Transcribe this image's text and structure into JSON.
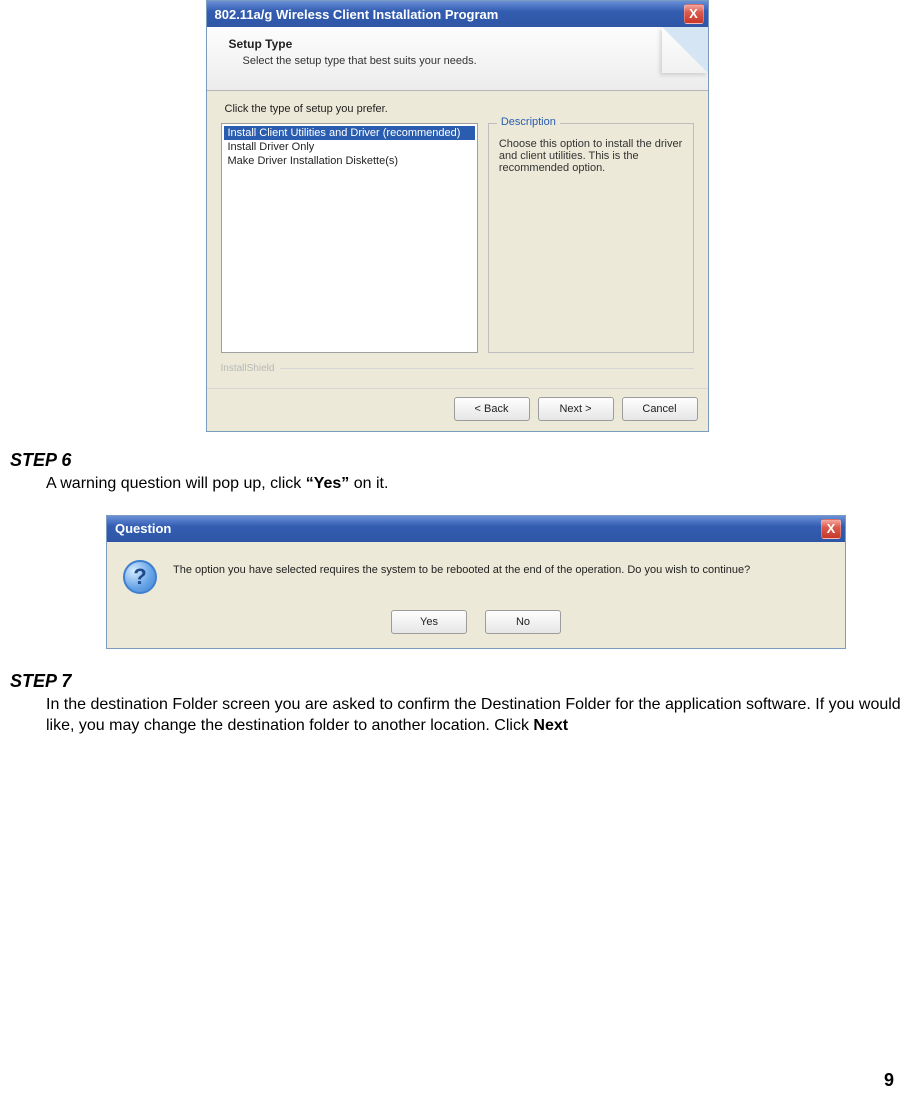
{
  "dialog1": {
    "title": "802.11a/g  Wireless Client Installation Program",
    "close": "X",
    "banner": {
      "title": "Setup Type",
      "desc": "Select the setup type that best suits your needs."
    },
    "prompt": "Click the type of setup you prefer.",
    "options": [
      "Install Client Utilities and Driver (recommended)",
      "Install Driver Only",
      "Make Driver Installation Diskette(s)"
    ],
    "descPanel": {
      "legend": "Description",
      "text": "Choose this option to install the driver and client utilities. This is the recommended option."
    },
    "installShield": "InstallShield",
    "buttons": {
      "back": "< Back",
      "next": "Next >",
      "cancel": "Cancel"
    }
  },
  "step6": {
    "label": "STEP 6",
    "text_prefix": "A warning question will pop up, click ",
    "text_bold": "“Yes”",
    "text_suffix": " on it."
  },
  "dialog2": {
    "title": "Question",
    "close": "X",
    "icon": "?",
    "message": "The option you have selected requires the system to be rebooted at the end of the operation. Do you wish to continue?",
    "buttons": {
      "yes": "Yes",
      "no": "No"
    }
  },
  "step7": {
    "label": "STEP 7",
    "text_prefix": "In the destination Folder screen you are asked to confirm the Destination Folder for the application software. If you would like, you may change the destination folder to another location. Click ",
    "text_bold": "Next"
  },
  "pageNumber": "9"
}
